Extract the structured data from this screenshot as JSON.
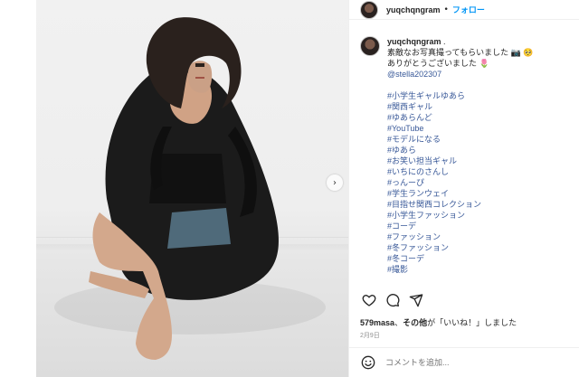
{
  "post": {
    "username": "yuqchqngram",
    "follow_label": "フォロー",
    "dot": "•",
    "next_arrow": "›"
  },
  "caption": {
    "username": "yuqchqngram",
    "suffix": " .",
    "lines": [
      "素敵なお写真撮ってもらいました 📷 🥺",
      "ありがとうございました 🌷"
    ],
    "mention": "@stella202307",
    "hashtags": [
      "#小学生ギャルゆあら",
      "#関西ギャル",
      "#ゆあらんど",
      "#YouTube",
      "#モデルになる",
      "#ゆあら",
      "#お笑い担当ギャル",
      "#いちにのさんし",
      "#っんーぴ",
      "#学生ランウェイ",
      "#目指せ関西コレクション",
      "#小学生ファッション",
      "#コーデ",
      "#ファッション",
      "#冬ファッション",
      "#冬コーデ",
      "#撮影"
    ]
  },
  "likes": {
    "user": "579masa",
    "connector": "、",
    "others": "その他",
    "tail": "が「いいね！」しました"
  },
  "date": "2月9日",
  "comment": {
    "placeholder": "コメントを追加..."
  },
  "icons": {
    "like": "heart-icon",
    "comment": "comment-icon",
    "share": "share-icon",
    "emoji": "emoji-icon"
  }
}
